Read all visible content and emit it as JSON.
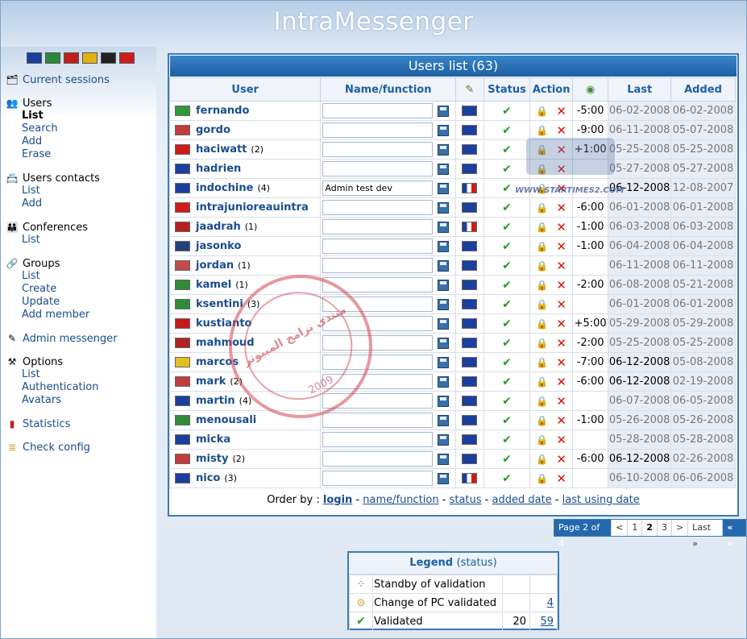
{
  "app": {
    "title": "IntraMessenger"
  },
  "sidebar": {
    "flags": [
      {
        "name": "fr-flag",
        "color": "#1b3f9e"
      },
      {
        "name": "it-flag",
        "color": "#2a8a3a"
      },
      {
        "name": "pt-flag",
        "color": "#c0201d"
      },
      {
        "name": "es-flag",
        "color": "#e3b210"
      },
      {
        "name": "de-flag",
        "color": "#222222"
      },
      {
        "name": "tr-flag",
        "color": "#d11a1a"
      }
    ],
    "current_sessions": "Current sessions",
    "users": {
      "label": "Users",
      "items": [
        "List",
        "Search",
        "Add",
        "Erase"
      ]
    },
    "users_contacts": {
      "label": "Users contacts",
      "items": [
        "List",
        "Add"
      ]
    },
    "conferences": {
      "label": "Conferences",
      "items": [
        "List"
      ]
    },
    "groups": {
      "label": "Groups",
      "items": [
        "List",
        "Create",
        "Update",
        "Add member"
      ]
    },
    "admin_messenger": "Admin messenger",
    "options": {
      "label": "Options",
      "items": [
        "List",
        "Authentication",
        "Avatars"
      ]
    },
    "statistics": "Statistics",
    "check_config": "Check config"
  },
  "users_panel": {
    "title": "Users list (63)",
    "columns": {
      "user": "User",
      "name_function": "Name/function",
      "status": "Status",
      "action": "Action",
      "last": "Last",
      "added": "Added"
    },
    "rows": [
      {
        "name": "fernando",
        "count": "",
        "function": "",
        "flag": "#2f9a3a",
        "lang": "uk",
        "tz": "-5:00",
        "last": "06-02-2008",
        "added": "06-02-2008",
        "recent": false
      },
      {
        "name": "gordo",
        "count": "",
        "function": "",
        "flag": "#c43b3b",
        "lang": "uk",
        "tz": "-9:00",
        "last": "06-11-2008",
        "added": "05-07-2008",
        "recent": false
      },
      {
        "name": "haciwatt",
        "count": "(2)",
        "function": "",
        "flag": "#d11a1a",
        "lang": "uk",
        "tz": "+1:00",
        "last": "05-25-2008",
        "added": "05-25-2008",
        "recent": false
      },
      {
        "name": "hadrien",
        "count": "",
        "function": "",
        "flag": "#1b3f9e",
        "lang": "uk",
        "tz": "",
        "last": "05-27-2008",
        "added": "05-27-2008",
        "recent": false
      },
      {
        "name": "indochine",
        "count": "(4)",
        "function": "Admin test dev",
        "flag": "#1b3f9e",
        "lang": "fr",
        "tz": "",
        "last": "06-12-2008",
        "added": "12-08-2007",
        "recent": true
      },
      {
        "name": "intrajunioreauintra",
        "count": "",
        "function": "",
        "flag": "#d11a1a",
        "lang": "uk",
        "tz": "-6:00",
        "last": "06-01-2008",
        "added": "06-01-2008",
        "recent": false
      },
      {
        "name": "jaadrah",
        "count": "(1)",
        "function": "",
        "flag": "#b52020",
        "lang": "fr",
        "tz": "-1:00",
        "last": "06-03-2008",
        "added": "06-03-2008",
        "recent": false
      },
      {
        "name": "jasonko",
        "count": "",
        "function": "",
        "flag": "#24407a",
        "lang": "uk",
        "tz": "-1:00",
        "last": "06-04-2008",
        "added": "06-04-2008",
        "recent": false
      },
      {
        "name": "jordan",
        "count": "(1)",
        "function": "",
        "flag": "#c24a4a",
        "lang": "uk",
        "tz": "",
        "last": "06-11-2008",
        "added": "06-11-2008",
        "recent": false
      },
      {
        "name": "kamel",
        "count": "(1)",
        "function": "",
        "flag": "#2f8a3a",
        "lang": "uk",
        "tz": "-2:00",
        "last": "06-08-2008",
        "added": "05-21-2008",
        "recent": false
      },
      {
        "name": "ksentini",
        "count": "(3)",
        "function": "",
        "flag": "#2f8a3a",
        "lang": "uk",
        "tz": "",
        "last": "06-01-2008",
        "added": "06-01-2008",
        "recent": false
      },
      {
        "name": "kustianto",
        "count": "",
        "function": "",
        "flag": "#c41a1a",
        "lang": "uk",
        "tz": "+5:00",
        "last": "05-29-2008",
        "added": "05-29-2008",
        "recent": false
      },
      {
        "name": "mahmoud",
        "count": "",
        "function": "",
        "flag": "#b52020",
        "lang": "uk",
        "tz": "-2:00",
        "last": "05-25-2008",
        "added": "05-25-2008",
        "recent": false
      },
      {
        "name": "marcos",
        "count": "",
        "function": "",
        "flag": "#e3c020",
        "lang": "uk",
        "tz": "-7:00",
        "last": "06-12-2008",
        "added": "05-08-2008",
        "recent": true
      },
      {
        "name": "mark",
        "count": "(2)",
        "function": "",
        "flag": "#c43b3b",
        "lang": "uk",
        "tz": "-6:00",
        "last": "06-12-2008",
        "added": "02-19-2008",
        "recent": true
      },
      {
        "name": "martin",
        "count": "(4)",
        "function": "",
        "flag": "#1b3f9e",
        "lang": "uk",
        "tz": "",
        "last": "06-07-2008",
        "added": "06-05-2008",
        "recent": false
      },
      {
        "name": "menousali",
        "count": "",
        "function": "",
        "flag": "#2f8a3a",
        "lang": "uk",
        "tz": "-1:00",
        "last": "05-26-2008",
        "added": "05-26-2008",
        "recent": false
      },
      {
        "name": "micka",
        "count": "",
        "function": "",
        "flag": "#1b3f9e",
        "lang": "uk",
        "tz": "",
        "last": "05-28-2008",
        "added": "05-28-2008",
        "recent": false
      },
      {
        "name": "misty",
        "count": "(2)",
        "function": "",
        "flag": "#c43b3b",
        "lang": "uk",
        "tz": "-6:00",
        "last": "06-12-2008",
        "added": "02-26-2008",
        "recent": true
      },
      {
        "name": "nico",
        "count": "(3)",
        "function": "",
        "flag": "#1b3f9e",
        "lang": "fr",
        "tz": "",
        "last": "06-10-2008",
        "added": "06-06-2008",
        "recent": false
      }
    ],
    "order_by": {
      "label": "Order by :",
      "links": [
        "login",
        "name/function",
        "status",
        "added date",
        "last using date"
      ]
    }
  },
  "pager": {
    "info": "Page 2 of 4",
    "prev": "<",
    "pages": [
      "1",
      "2",
      "3"
    ],
    "next": ">",
    "last": "Last »",
    "go": "« »"
  },
  "legend": {
    "title": "Legend",
    "subtitle": "(status)",
    "rows": [
      {
        "label": "Standby of validation",
        "count": "",
        "link": ""
      },
      {
        "label": "Change of PC validated",
        "count": "",
        "link": "4"
      },
      {
        "label": "Validated",
        "count": "20",
        "link": "59"
      }
    ]
  },
  "watermarks": {
    "stamp_line1": "منتدى برامج المبيوتر",
    "stamp_line2": "2009",
    "site_url": "WWW.STARTIMES2.COM"
  }
}
